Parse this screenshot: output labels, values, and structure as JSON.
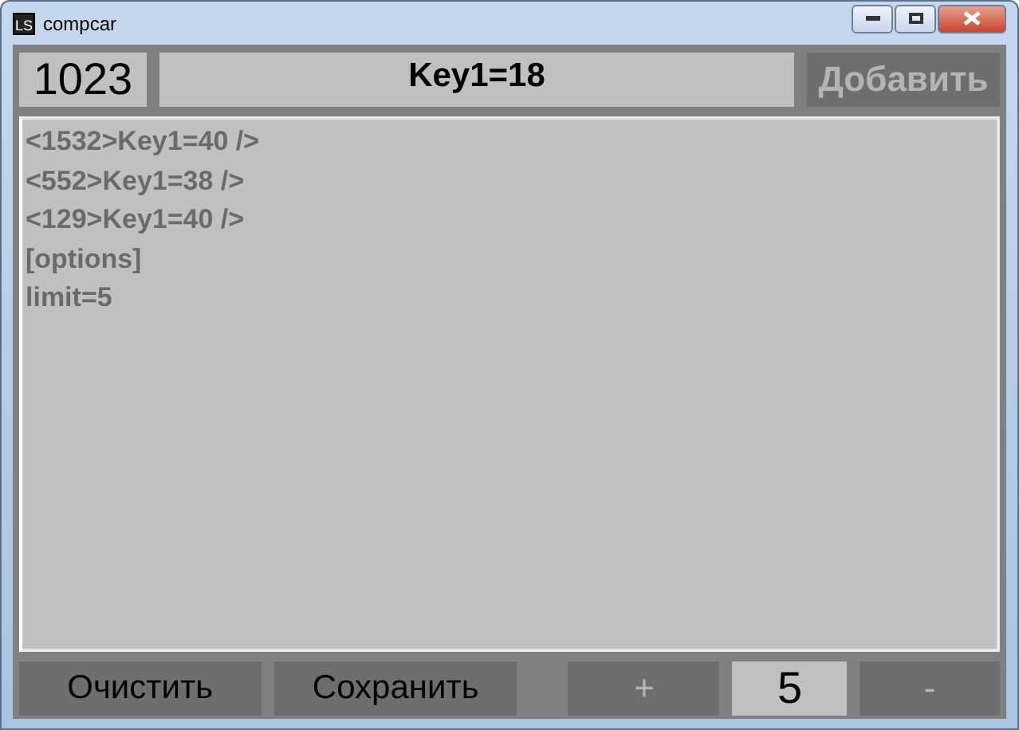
{
  "window": {
    "title": "compcar",
    "icon": "LS"
  },
  "top": {
    "counter": "1023",
    "key_field": "Key1=18",
    "add_button": {
      "label": "Добавить",
      "disabled": true
    }
  },
  "lines": [
    "<1532>Key1=40 />",
    "<552>Key1=38 />",
    "<129>Key1=40 />",
    "[options]",
    "limit=5"
  ],
  "bottom": {
    "clear_button": "Очистить",
    "save_button": "Сохранить",
    "plus_button": "+",
    "limit_value": "5",
    "minus_button": "-"
  }
}
